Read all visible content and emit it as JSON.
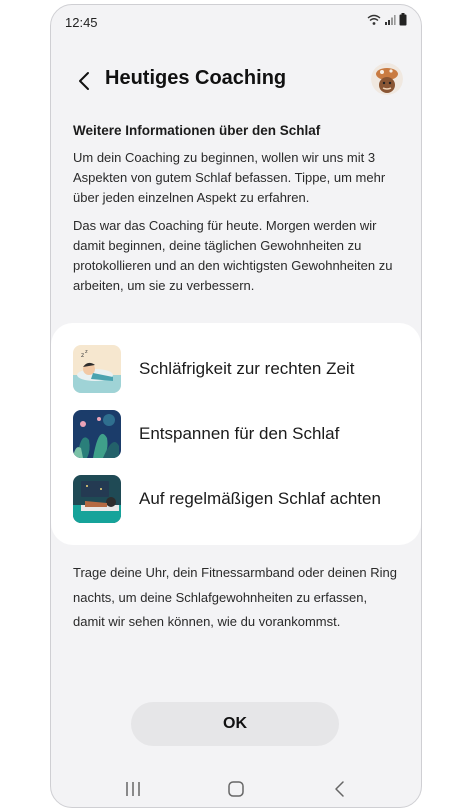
{
  "status_bar": {
    "time": "12:45"
  },
  "header": {
    "title": "Heutiges Coaching"
  },
  "intro": {
    "heading": "Weitere Informationen über den Schlaf",
    "paragraph_1": "Um dein Coaching zu beginnen, wollen wir uns mit 3 Aspekten von gutem Schlaf befassen. Tippe, um mehr über jeden einzelnen Aspekt zu erfahren.",
    "paragraph_2": "Das war das Coaching für heute. Morgen werden wir damit beginnen, deine täglichen Gewohnheiten zu protokollieren und an den wichtigsten Gewohnheiten zu arbeiten, um sie zu verbessern."
  },
  "aspects": [
    {
      "label": "Schläfrigkeit zur rechten Zeit",
      "icon": "sleepy-person-icon"
    },
    {
      "label": "Entspannen für den Schlaf",
      "icon": "relaxing-plants-icon"
    },
    {
      "label": "Auf regelmäßigen Schlaf achten",
      "icon": "regular-sleep-icon"
    }
  ],
  "footer_text": "Trage deine Uhr, dein Fitnessarmband oder deinen Ring nachts, um deine Schlafgewohnheiten zu erfassen, damit wir sehen können, wie du vorankommst.",
  "buttons": {
    "ok": "OK"
  },
  "colors": {
    "background": "#f3f3f5",
    "card": "#ffffff",
    "button": "#e6e6e8"
  }
}
